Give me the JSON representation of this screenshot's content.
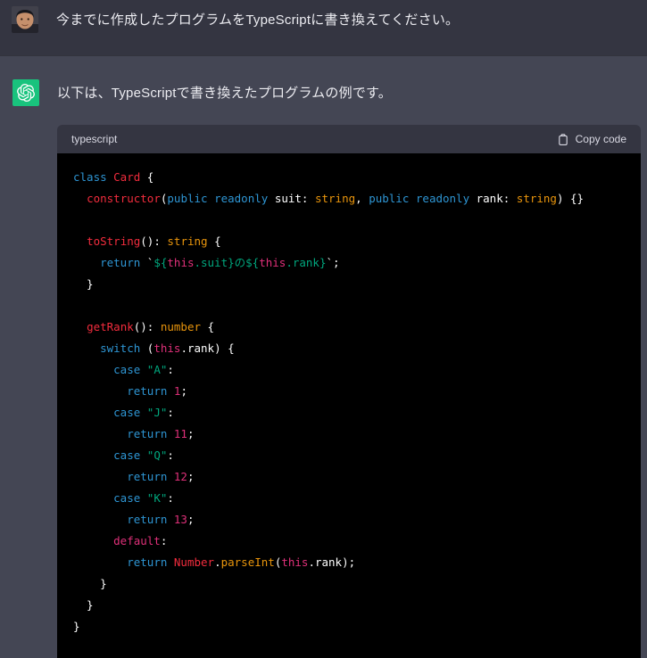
{
  "colors": {
    "keyword": "#2e95d3",
    "title": "#f22c3d",
    "builtin": "#e9950c",
    "string": "#00a67d",
    "number": "#df3079",
    "plain": "#ffffff",
    "avatar_green": "#19c37d",
    "user_row_bg": "#343541",
    "assistant_row_bg": "#444654",
    "code_bg": "#000000"
  },
  "user_message": {
    "text": "今までに作成したプログラムをTypeScriptに書き換えてください。"
  },
  "assistant_message": {
    "text": "以下は、TypeScriptで書き換えたプログラムの例です。"
  },
  "code_block": {
    "language_label": "typescript",
    "copy_button_label": "Copy code",
    "lines": [
      [
        [
          "kw",
          "class "
        ],
        [
          "fn",
          "Card"
        ],
        [
          "pl",
          " {"
        ]
      ],
      [
        [
          "pl",
          "  "
        ],
        [
          "fn",
          "constructor"
        ],
        [
          "pl",
          "("
        ],
        [
          "kw",
          "public"
        ],
        [
          "pl",
          " "
        ],
        [
          "kw",
          "readonly"
        ],
        [
          "pl",
          " suit: "
        ],
        [
          "type",
          "string"
        ],
        [
          "pl",
          ", "
        ],
        [
          "kw",
          "public"
        ],
        [
          "pl",
          " "
        ],
        [
          "kw",
          "readonly"
        ],
        [
          "pl",
          " rank: "
        ],
        [
          "type",
          "string"
        ],
        [
          "pl",
          ") {}"
        ]
      ],
      [],
      [
        [
          "pl",
          "  "
        ],
        [
          "fn",
          "toString"
        ],
        [
          "pl",
          "(): "
        ],
        [
          "type",
          "string"
        ],
        [
          "pl",
          " {"
        ]
      ],
      [
        [
          "pl",
          "    "
        ],
        [
          "kw",
          "return"
        ],
        [
          "pl",
          " `"
        ],
        [
          "str",
          "${"
        ],
        [
          "num",
          "this"
        ],
        [
          "str",
          ".suit}の${"
        ],
        [
          "num",
          "this"
        ],
        [
          "str",
          ".rank}"
        ],
        [
          "pl",
          "`;"
        ]
      ],
      [
        [
          "pl",
          "  }"
        ]
      ],
      [],
      [
        [
          "pl",
          "  "
        ],
        [
          "fn",
          "getRank"
        ],
        [
          "pl",
          "(): "
        ],
        [
          "type",
          "number"
        ],
        [
          "pl",
          " {"
        ]
      ],
      [
        [
          "pl",
          "    "
        ],
        [
          "kw",
          "switch"
        ],
        [
          "pl",
          " ("
        ],
        [
          "num",
          "this"
        ],
        [
          "pl",
          ".rank) {"
        ]
      ],
      [
        [
          "pl",
          "      "
        ],
        [
          "kw",
          "case "
        ],
        [
          "str",
          "\"A\""
        ],
        [
          "pl",
          ":"
        ]
      ],
      [
        [
          "pl",
          "        "
        ],
        [
          "kw",
          "return"
        ],
        [
          "pl",
          " "
        ],
        [
          "num",
          "1"
        ],
        [
          "pl",
          ";"
        ]
      ],
      [
        [
          "pl",
          "      "
        ],
        [
          "kw",
          "case "
        ],
        [
          "str",
          "\"J\""
        ],
        [
          "pl",
          ":"
        ]
      ],
      [
        [
          "pl",
          "        "
        ],
        [
          "kw",
          "return"
        ],
        [
          "pl",
          " "
        ],
        [
          "num",
          "11"
        ],
        [
          "pl",
          ";"
        ]
      ],
      [
        [
          "pl",
          "      "
        ],
        [
          "kw",
          "case "
        ],
        [
          "str",
          "\"Q\""
        ],
        [
          "pl",
          ":"
        ]
      ],
      [
        [
          "pl",
          "        "
        ],
        [
          "kw",
          "return"
        ],
        [
          "pl",
          " "
        ],
        [
          "num",
          "12"
        ],
        [
          "pl",
          ";"
        ]
      ],
      [
        [
          "pl",
          "      "
        ],
        [
          "kw",
          "case "
        ],
        [
          "str",
          "\"K\""
        ],
        [
          "pl",
          ":"
        ]
      ],
      [
        [
          "pl",
          "        "
        ],
        [
          "kw",
          "return"
        ],
        [
          "pl",
          " "
        ],
        [
          "num",
          "13"
        ],
        [
          "pl",
          ";"
        ]
      ],
      [
        [
          "pl",
          "      "
        ],
        [
          "num",
          "default"
        ],
        [
          "pl",
          ":"
        ]
      ],
      [
        [
          "pl",
          "        "
        ],
        [
          "kw",
          "return"
        ],
        [
          "pl",
          " "
        ],
        [
          "fn",
          "Number"
        ],
        [
          "pl",
          "."
        ],
        [
          "type",
          "parseInt"
        ],
        [
          "pl",
          "("
        ],
        [
          "num",
          "this"
        ],
        [
          "pl",
          ".rank);"
        ]
      ],
      [
        [
          "pl",
          "    }"
        ]
      ],
      [
        [
          "pl",
          "  }"
        ]
      ],
      [
        [
          "pl",
          "}"
        ]
      ]
    ]
  }
}
